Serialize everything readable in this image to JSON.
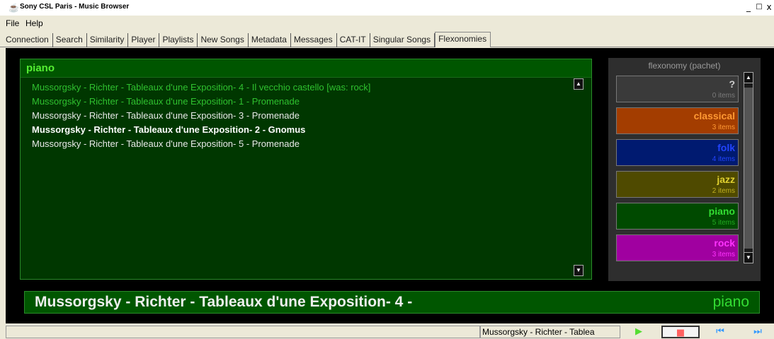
{
  "window": {
    "title": "Sony CSL Paris - Music Browser",
    "minimize": "_",
    "maximize": "□",
    "close": "x"
  },
  "menu": [
    "File",
    "Help"
  ],
  "tabs": [
    {
      "label": "Connection",
      "active": false
    },
    {
      "label": "Search",
      "active": false
    },
    {
      "label": "Similarity",
      "active": false
    },
    {
      "label": "Player",
      "active": false
    },
    {
      "label": "Playlists",
      "active": false
    },
    {
      "label": "New Songs",
      "active": false
    },
    {
      "label": "Metadata",
      "active": false
    },
    {
      "label": "Messages",
      "active": false
    },
    {
      "label": "CAT-IT",
      "active": false
    },
    {
      "label": "Singular Songs",
      "active": false
    },
    {
      "label": "Flexonomies",
      "active": true
    }
  ],
  "playlist": {
    "title": "piano",
    "songs": [
      {
        "text": "Mussorgsky - Richter - Tableaux d'une Exposition- 4 - Il vecchio castello    [was: rock]",
        "color": "#2fc02f",
        "bold": false
      },
      {
        "text": "Mussorgsky - Richter - Tableaux d'une Exposition- 1 - Promenade",
        "color": "#2fc02f",
        "bold": false
      },
      {
        "text": "Mussorgsky - Richter - Tableaux d'une Exposition- 3 - Promenade",
        "color": "#e8e8e8",
        "bold": false
      },
      {
        "text": "Mussorgsky - Richter - Tableaux d'une Exposition- 2 - Gnomus",
        "color": "#ffffff",
        "bold": true
      },
      {
        "text": "Mussorgsky - Richter - Tableaux d'une Exposition- 5 - Promenade",
        "color": "#e8e8e8",
        "bold": false
      }
    ]
  },
  "flexonomy": {
    "title": "flexonomy (pachet)",
    "categories": [
      {
        "name": "?",
        "count": "0 items",
        "bg": "#3a3a3a",
        "name_color": "#cfcfcf",
        "count_color": "#7a7a7a"
      },
      {
        "name": "classical",
        "count": "3 items",
        "bg": "#a33d00",
        "name_color": "#ff9933",
        "count_color": "#ff9933"
      },
      {
        "name": "folk",
        "count": "4 items",
        "bg": "#001a70",
        "name_color": "#2244ff",
        "count_color": "#2244ff"
      },
      {
        "name": "jazz",
        "count": "2 items",
        "bg": "#4f4a00",
        "name_color": "#e0d030",
        "count_color": "#c0b020"
      },
      {
        "name": "piano",
        "count": "5 items",
        "bg": "#004a00",
        "name_color": "#33dd33",
        "count_color": "#22aa22"
      },
      {
        "name": "rock",
        "count": "3 items",
        "bg": "#a000a0",
        "name_color": "#ff33ff",
        "count_color": "#ff33ff"
      }
    ]
  },
  "now_playing": {
    "title": "Mussorgsky - Richter - Tableaux d'une Exposition- 4 -",
    "category": "piano"
  },
  "status": {
    "song": "Mussorgsky - Richter - Tablea"
  },
  "controls": {
    "play": "▶",
    "stop": "■",
    "previous": "⏮",
    "next": "⏭"
  }
}
